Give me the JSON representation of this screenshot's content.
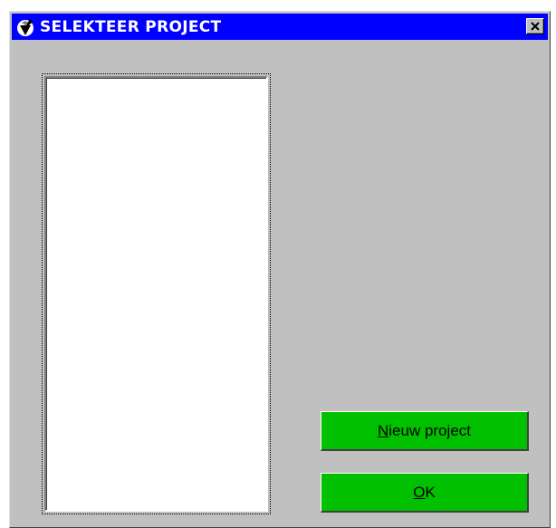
{
  "window": {
    "title": "SELEKTEER PROJECT",
    "app_icon": "app-logo-icon",
    "close_icon": "close-icon"
  },
  "project_list": {
    "items": []
  },
  "buttons": {
    "new_project": {
      "mnemonic": "N",
      "label_rest": "ieuw project",
      "bg_color": "#00c000"
    },
    "ok": {
      "mnemonic": "O",
      "label_rest": "K",
      "bg_color": "#00c000"
    }
  },
  "colors": {
    "titlebar": "#0000ff",
    "dialog_bg": "#c0c0c0",
    "listbox_bg": "#ffffff"
  }
}
